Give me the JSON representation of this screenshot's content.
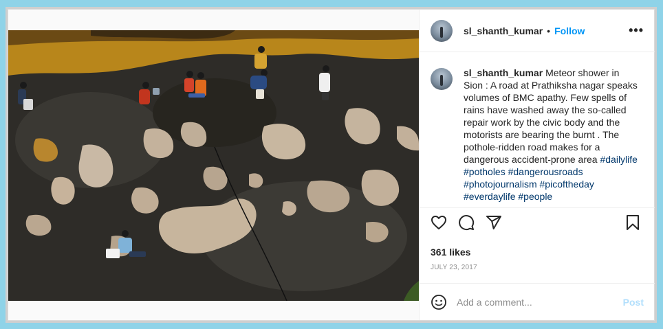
{
  "post": {
    "author": "sl_shanth_kumar",
    "follow_label": "Follow",
    "separator": "•",
    "more_icon": "ellipsis-horizontal-icon",
    "caption_text": "Meteor shower in Sion : A road at Prathiksha nagar speaks volumes of BMC apathy. Few spells of rains have washed away the so-called repair work by the civic body and the motorists are bearing the burnt . The pothole-ridden road makes for a dangerous accident-prone area",
    "hashtags": [
      "#dailylife",
      "#potholes",
      "#dangerousroads",
      "#photojournalism",
      "#picoftheday",
      "#everdaylife",
      "#people"
    ],
    "likes": "361 likes",
    "date": "JULY 23, 2017"
  },
  "comment_box": {
    "placeholder": "Add a comment...",
    "post_label": "Post"
  },
  "colors": {
    "background": "#8fd3e8",
    "link": "#0095f6",
    "hashtag": "#00376b",
    "post_disabled": "#b2dffc",
    "muted": "#8e8e8e"
  },
  "icons": [
    "heart-icon",
    "comment-icon",
    "share-icon",
    "bookmark-icon",
    "emoji-icon"
  ]
}
